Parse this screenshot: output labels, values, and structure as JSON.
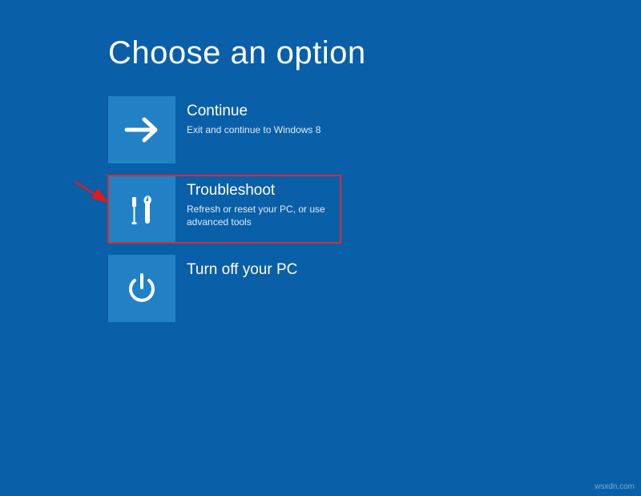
{
  "title": "Choose an option",
  "options": {
    "continue": {
      "title": "Continue",
      "desc": "Exit and continue to Windows 8"
    },
    "troubleshoot": {
      "title": "Troubleshoot",
      "desc": "Refresh or reset your PC, or use advanced tools"
    },
    "turnoff": {
      "title": "Turn off your PC",
      "desc": ""
    }
  },
  "watermark": "wsxdn.com"
}
